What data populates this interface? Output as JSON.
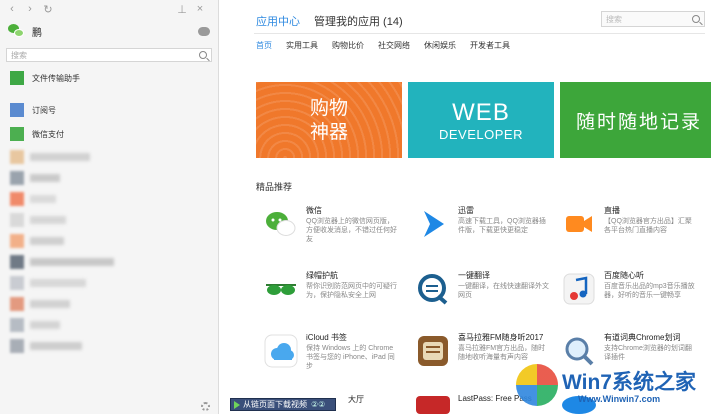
{
  "sidebar": {
    "topbar": {
      "back": "‹",
      "forward": "›",
      "refresh": "↻",
      "pin": "⊥",
      "close": "×"
    },
    "user": {
      "name": "鹏"
    },
    "search": {
      "placeholder": "搜索"
    },
    "chats": [
      {
        "name": "文件传输助手",
        "color": "#3ea845"
      },
      {
        "name": "订阅号",
        "color": "#5b8bd0"
      },
      {
        "name": "微信支付",
        "color": "#4caf50"
      }
    ]
  },
  "main": {
    "tabs": [
      {
        "label": "应用中心"
      },
      {
        "label": "管理我的应用 (14)"
      }
    ],
    "search_placeholder": "搜索",
    "categories": [
      "首页",
      "实用工具",
      "购物比价",
      "社交网络",
      "休闲娱乐",
      "开发者工具"
    ],
    "banners": {
      "shop": {
        "line1": "购物",
        "line2": "神器",
        "color": "#f0782b"
      },
      "web": {
        "line1": "WEB",
        "line2": "DEVELOPER",
        "color": "#22b3bd"
      },
      "note": {
        "text": "随时随地记录",
        "color": "#3da63a"
      }
    },
    "section_title": "精品推荐",
    "apps": [
      {
        "name": "微信",
        "desc": "QQ浏览器上的微信网页版，方便收发消息，不错过任何好友",
        "icon": "wechat-icon"
      },
      {
        "name": "迅雷",
        "desc": "高速下载工具，QQ浏览器插件版，下载更快更稳定",
        "icon": "xunlei-icon"
      },
      {
        "name": "直播",
        "desc": "【QQ浏览器官方出品】汇聚各平台热门直播内容",
        "icon": "live-icon"
      },
      {
        "name": "绿帽护航",
        "desc": "帮你识别防范网页中的可疑行为，保护隐私安全上网",
        "icon": "glasses-icon"
      },
      {
        "name": "一键翻译",
        "desc": "一键翻译，在线快速翻译外文网页",
        "icon": "translate-icon"
      },
      {
        "name": "百度随心听",
        "desc": "百度音乐出品的mp3音乐播放器，好听的音乐一键畅享",
        "icon": "music-icon"
      },
      {
        "name": "iCloud 书签",
        "desc": "保持 Windows 上的 Chrome 书签与您的 iPhone、iPad 同步",
        "icon": "icloud-icon"
      },
      {
        "name": "喜马拉雅FM随身听2017",
        "desc": "喜马拉雅FM官方出品，随时随地收听海量有声内容",
        "icon": "radio-icon"
      },
      {
        "name": "有道词典Chrome划词",
        "desc": "支持Chrome浏览器的划词翻译插件",
        "icon": "dict-icon"
      },
      {
        "name": "大厅",
        "desc": "",
        "icon": "hall-icon"
      },
      {
        "name": "LastPass: Free Pass",
        "desc": "",
        "icon": "lastpass-icon"
      },
      {
        "name": "",
        "desc": "",
        "icon": "blue-app-icon"
      }
    ]
  },
  "overlay": {
    "download_label": "从链页面下载视频",
    "page_num": "②②",
    "watermark_title": "Win7系统之家",
    "watermark_url": "Www.Winwin7.com"
  },
  "colors": {
    "accent": "#2f8ae0"
  }
}
